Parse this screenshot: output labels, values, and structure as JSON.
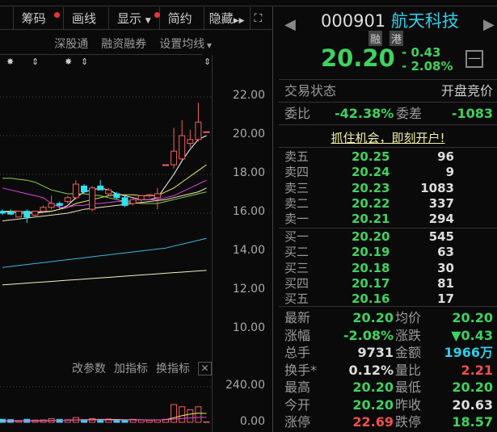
{
  "top_menu": [
    "",
    "",
    "",
    ""
  ],
  "toolbar": {
    "chips": "筹码",
    "draw": "画线",
    "display": "显示",
    "simple": "简约",
    "hide": "隐藏"
  },
  "subbar": {
    "sgt": "深股通",
    "margin": "融资融券",
    "ma": "设置均线"
  },
  "price_axis": [
    "22.00",
    "20.00",
    "18.00",
    "16.00",
    "14.00",
    "12.00",
    "10.00"
  ],
  "indicator_bar": {
    "params": "改参数",
    "add": "加指标",
    "switch": "换指标"
  },
  "volume_axis": [
    "240.00",
    "0.00"
  ],
  "chart_data": {
    "type": "candlestick",
    "ylim": [
      10,
      22
    ],
    "candles": [
      [
        16.1,
        16.2,
        15.9,
        16.0
      ],
      [
        16.05,
        16.2,
        15.9,
        15.95
      ],
      [
        15.8,
        16.1,
        15.8,
        16.1
      ],
      [
        16.1,
        16.2,
        15.5,
        15.8
      ],
      [
        15.9,
        16.1,
        15.8,
        16.1
      ],
      [
        16.1,
        16.4,
        16.0,
        16.3
      ],
      [
        16.3,
        16.9,
        16.2,
        16.5
      ],
      [
        16.5,
        16.6,
        16.2,
        16.4
      ],
      [
        16.6,
        16.9,
        16.5,
        16.8
      ],
      [
        16.8,
        17.7,
        16.7,
        17.5
      ],
      [
        17.4,
        17.5,
        17.0,
        17.1
      ],
      [
        16.2,
        17.4,
        16.1,
        17.3
      ],
      [
        17.4,
        17.7,
        17.2,
        17.2
      ],
      [
        17.0,
        17.3,
        16.9,
        17.2
      ],
      [
        17.0,
        17.1,
        16.7,
        16.8
      ],
      [
        16.8,
        16.9,
        16.3,
        16.4
      ],
      [
        16.5,
        16.8,
        16.4,
        16.7
      ],
      [
        16.7,
        16.9,
        16.6,
        16.9
      ],
      [
        16.9,
        17.0,
        16.8,
        16.95
      ],
      [
        16.8,
        17.3,
        16.2,
        17.0
      ],
      [
        18.5,
        18.5,
        18.5,
        18.5
      ],
      [
        18.5,
        20.4,
        18.3,
        19.2
      ],
      [
        18.8,
        20.8,
        18.7,
        20.0
      ],
      [
        19.6,
        20.3,
        19.4,
        19.8
      ],
      [
        19.8,
        21.7,
        19.7,
        20.7
      ],
      [
        20.2,
        20.2,
        20.2,
        20.2
      ]
    ],
    "ma": [
      {
        "color": "#ffffff",
        "values": [
          16.1,
          16.05,
          16.0,
          16.0,
          16.0,
          16.05,
          16.1,
          16.2,
          16.4,
          16.8,
          17.1,
          17.2,
          17.3,
          17.2,
          17.0,
          16.9,
          16.8,
          16.7,
          16.7,
          16.8,
          17.4,
          18.0,
          18.7,
          19.3,
          19.8,
          20.0
        ]
      },
      {
        "color": "#f5e663",
        "values": [
          16.1,
          16.1,
          16.1,
          16.05,
          16.05,
          16.1,
          16.1,
          16.2,
          16.3,
          16.5,
          16.6,
          16.7,
          16.8,
          16.9,
          16.95,
          16.95,
          16.95,
          16.9,
          16.9,
          16.9,
          17.1,
          17.3,
          17.6,
          17.9,
          18.2,
          18.5
        ]
      },
      {
        "color": "#e040e0",
        "values": [
          17.3,
          17.2,
          17.1,
          17.0,
          16.9,
          16.8,
          16.5,
          16.3,
          16.3,
          16.4,
          16.4,
          16.5,
          16.5,
          16.55,
          16.6,
          16.6,
          16.65,
          16.7,
          16.7,
          16.7,
          16.8,
          16.9,
          17.1,
          17.3,
          17.5,
          17.7
        ]
      },
      {
        "color": "#8ad04a",
        "values": [
          17.8,
          17.8,
          17.75,
          17.7,
          17.6,
          17.4,
          17.2,
          17.1,
          17.0,
          17.0,
          17.0,
          16.95,
          16.9,
          16.8,
          16.7,
          16.6,
          16.55,
          16.5,
          16.5,
          16.5,
          16.6,
          16.7,
          16.8,
          16.9,
          17.0,
          17.1
        ]
      },
      {
        "color": "#f2e6b8",
        "values": [
          15.6,
          15.65,
          15.7,
          15.75,
          15.8,
          15.85,
          15.9,
          15.95,
          16.0,
          16.1,
          16.2,
          16.25,
          16.3,
          16.35,
          16.4,
          16.45,
          16.5,
          16.55,
          16.6,
          16.65,
          16.7,
          16.8,
          16.9,
          17.0,
          17.1,
          17.3
        ]
      },
      {
        "color": "#3bb6e0",
        "values": [
          13.2,
          13.25,
          13.3,
          13.35,
          13.4,
          13.45,
          13.5,
          13.55,
          13.6,
          13.65,
          13.7,
          13.75,
          13.8,
          13.85,
          13.9,
          13.95,
          14.0,
          14.05,
          14.1,
          14.15,
          14.2,
          14.3,
          14.4,
          14.5,
          14.6,
          14.7
        ]
      },
      {
        "color": "#f5f0c0",
        "values": [
          12.3,
          12.33,
          12.36,
          12.39,
          12.42,
          12.45,
          12.48,
          12.51,
          12.54,
          12.57,
          12.6,
          12.63,
          12.66,
          12.69,
          12.72,
          12.75,
          12.78,
          12.81,
          12.84,
          12.87,
          12.9,
          12.93,
          12.96,
          12.99,
          13.02,
          13.05
        ]
      }
    ],
    "volume": [
      20,
      18,
      12,
      20,
      15,
      16,
      25,
      20,
      17,
      32,
      18,
      25,
      20,
      22,
      18,
      13,
      20,
      16,
      13,
      16,
      20,
      120,
      105,
      85,
      105,
      3
    ],
    "volume_ylim": [
      0,
      240
    ]
  },
  "quote": {
    "code": "000901",
    "name": "航天科技",
    "tag1": "融",
    "tag2": "港",
    "price": "20.20",
    "change": "- 0.43",
    "pct": "- 2.08%",
    "status_label": "交易状态",
    "status": "开盘竞价",
    "wb_label": "委比",
    "wb": "-42.38%",
    "wc_label": "委差",
    "wc": "-1083",
    "promo": "抓住机会，即刻开户!"
  },
  "sells": [
    {
      "l": "卖五",
      "p": "20.25",
      "v": "96"
    },
    {
      "l": "卖四",
      "p": "20.24",
      "v": "9"
    },
    {
      "l": "卖三",
      "p": "20.23",
      "v": "1083"
    },
    {
      "l": "卖二",
      "p": "20.22",
      "v": "337"
    },
    {
      "l": "卖一",
      "p": "20.21",
      "v": "294"
    }
  ],
  "buys": [
    {
      "l": "买一",
      "p": "20.20",
      "v": "545"
    },
    {
      "l": "买二",
      "p": "20.19",
      "v": "63"
    },
    {
      "l": "买三",
      "p": "20.18",
      "v": "30"
    },
    {
      "l": "买四",
      "p": "20.17",
      "v": "81"
    },
    {
      "l": "买五",
      "p": "20.16",
      "v": "17"
    }
  ],
  "stats": [
    [
      {
        "l": "最新",
        "v": "20.20",
        "c": "g"
      },
      {
        "l": "均价",
        "v": "20.20",
        "c": "g"
      }
    ],
    [
      {
        "l": "涨幅",
        "v": "-2.08%",
        "c": "g"
      },
      {
        "l": "涨跌",
        "v": "▼0.43",
        "c": "g"
      }
    ],
    [
      {
        "l": "总手",
        "v": "9731",
        "c": "w"
      },
      {
        "l": "金额",
        "v": "1966万",
        "c": "c"
      }
    ],
    [
      {
        "l": "换手*",
        "v": "0.12%",
        "c": "w"
      },
      {
        "l": "量比",
        "v": "2.21",
        "c": "r"
      }
    ],
    [
      {
        "l": "最高",
        "v": "20.20",
        "c": "g"
      },
      {
        "l": "最低",
        "v": "20.20",
        "c": "g"
      }
    ],
    [
      {
        "l": "今开",
        "v": "20.20",
        "c": "g"
      },
      {
        "l": "昨收",
        "v": "20.63",
        "c": "w"
      }
    ],
    [
      {
        "l": "涨停",
        "v": "22.69",
        "c": "r"
      },
      {
        "l": "跌停",
        "v": "18.57",
        "c": "g"
      }
    ]
  ]
}
